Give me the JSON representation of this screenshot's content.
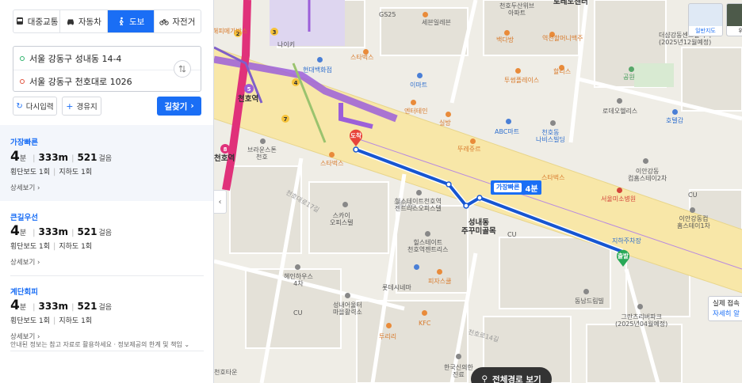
{
  "tabs": [
    {
      "label": "대중교통",
      "icon": "bus-icon",
      "active": false
    },
    {
      "label": "자동차",
      "icon": "car-icon",
      "active": false
    },
    {
      "label": "도보",
      "icon": "walk-icon",
      "active": true
    },
    {
      "label": "자전거",
      "icon": "bicycle-icon",
      "active": false
    }
  ],
  "route": {
    "origin": "서울 강동구 성내동 14-4",
    "destination": "서울 강동구 천호대로 1026"
  },
  "actions": {
    "reset": "다시입력",
    "waypoint": "경유지",
    "search": "길찾기"
  },
  "options": [
    {
      "label": "가장빠른",
      "minutes": "4",
      "minutes_unit": "분",
      "distance": "333m",
      "steps": "521",
      "steps_unit": "걸음",
      "crosswalk": "횡단보도 1회",
      "underpass": "지하도 1회",
      "more": "상세보기"
    },
    {
      "label": "큰길우선",
      "minutes": "4",
      "minutes_unit": "분",
      "distance": "333m",
      "steps": "521",
      "steps_unit": "걸음",
      "crosswalk": "횡단보도 1회",
      "underpass": "지하도 1회",
      "more": "상세보기"
    },
    {
      "label": "계단회피",
      "minutes": "4",
      "minutes_unit": "분",
      "distance": "333m",
      "steps": "521",
      "steps_unit": "걸음",
      "crosswalk": "횡단보도 1회",
      "underpass": "지하도 1회",
      "more": "상세보기"
    }
  ],
  "disclaimer": "안내된 정보는 참고 자료로 활용하세요 · 정보제공의 한계 및 책임",
  "map": {
    "map_types": {
      "normal": "일반지도",
      "satellite": "위성"
    },
    "badge": {
      "chip": "가장빠른",
      "time": "4분"
    },
    "start_pin": "도착",
    "end_pin": "출발",
    "full_route": "전체경로 보기",
    "tooltip": {
      "line1": "실제 접속",
      "line2": "자세히 알"
    },
    "labels": {
      "gs25": "GS25",
      "seven": "세븐일레븐",
      "cheonho_apt": "천호두산위브\n아파트",
      "toegye": "토레노센터",
      "daiso": "백다방",
      "yeokjeon": "역전할머니맥주",
      "leebang": "해피메가박스",
      "nike": "나이키",
      "hyundai": "현대백화점",
      "starbucks1": "스타벅스",
      "emart": "이마트",
      "twosome": "투썸플레이스",
      "hollys": "할리스",
      "park": "공원",
      "daesang": "더샵강동센트럴시티\n(2025년12월예정)",
      "rodeo": "로데오헬리스",
      "hotel": "호텔감",
      "cheonho_station1": "천호역",
      "cheonho_station2": "천호역",
      "brown": "브라운스톤\n천호",
      "starbucks2": "스타벅스",
      "entertainment": "엔터테인",
      "silbang": "실방",
      "lotte": "뚜레쥬르",
      "abc": "ABC마트",
      "cheonho_newbuilding": "천호동\n나비스빌딩",
      "starbucks3": "스타벅스",
      "ian": "이안강동\n컴홈스테이2차",
      "seoul_med": "서울미소병원",
      "cu1": "CU",
      "ian2": "이안강동컴\n홈스테이1차",
      "sky": "스카이\n오피스텔",
      "hillstate": "힐스테이트천호역\n젠트리스오피스텔",
      "seongnae": "성내동\n주꾸미골목",
      "cu2": "CU",
      "hillstate2": "힐스테이트\n천호역젠트리스",
      "parking": "지하주차장",
      "heinhouse": "헤인하우스\n4차",
      "pizza": "피자스쿨",
      "lotte_cinema": "롯데시네마",
      "dongnam": "동남드림빌",
      "grand": "그란츠리버파크\n(2025년04월예정)",
      "seongnae_ol": "성내어울터\n마을활력소",
      "kfc": "KFC",
      "cu3": "CU",
      "tourist": "투리리",
      "korea_lab": "한국신의한\n진료",
      "cheonhodaero": "천호대로",
      "cheonho17": "천호대로17길",
      "cheonho14": "천호로14길",
      "town": "천호타운"
    }
  }
}
